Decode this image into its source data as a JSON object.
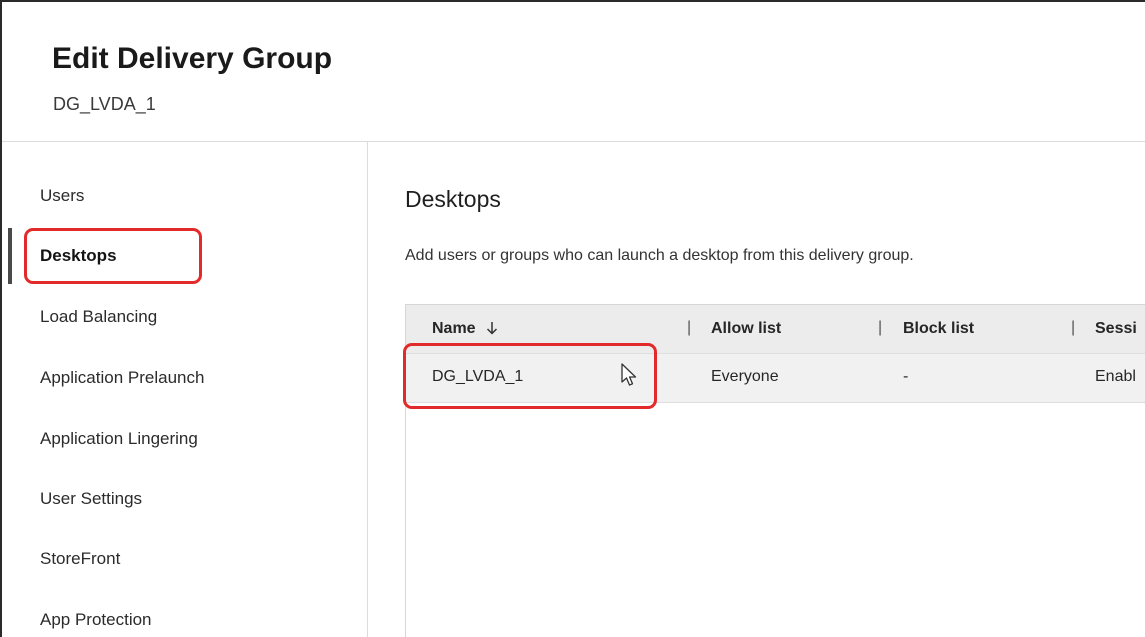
{
  "header": {
    "title": "Edit Delivery Group",
    "subtitle": "DG_LVDA_1"
  },
  "sidebar": {
    "items": [
      {
        "label": "Users"
      },
      {
        "label": "Desktops",
        "active": true
      },
      {
        "label": "Load Balancing"
      },
      {
        "label": "Application Prelaunch"
      },
      {
        "label": "Application Lingering"
      },
      {
        "label": "User Settings"
      },
      {
        "label": "StoreFront"
      },
      {
        "label": "App Protection"
      }
    ]
  },
  "main": {
    "title": "Desktops",
    "description": "Add users or groups who can launch a desktop from this delivery group.",
    "table": {
      "columns": [
        "Name",
        "Allow list",
        "Block list",
        "Sessi"
      ],
      "sort_icon": "arrow-down-icon",
      "rows": [
        [
          "DG_LVDA_1",
          "Everyone",
          "-",
          "Enabl"
        ]
      ]
    }
  },
  "colors": {
    "highlight": "#e32a2a",
    "header_bg": "#ececec",
    "row_bg": "#f1f1f1"
  }
}
